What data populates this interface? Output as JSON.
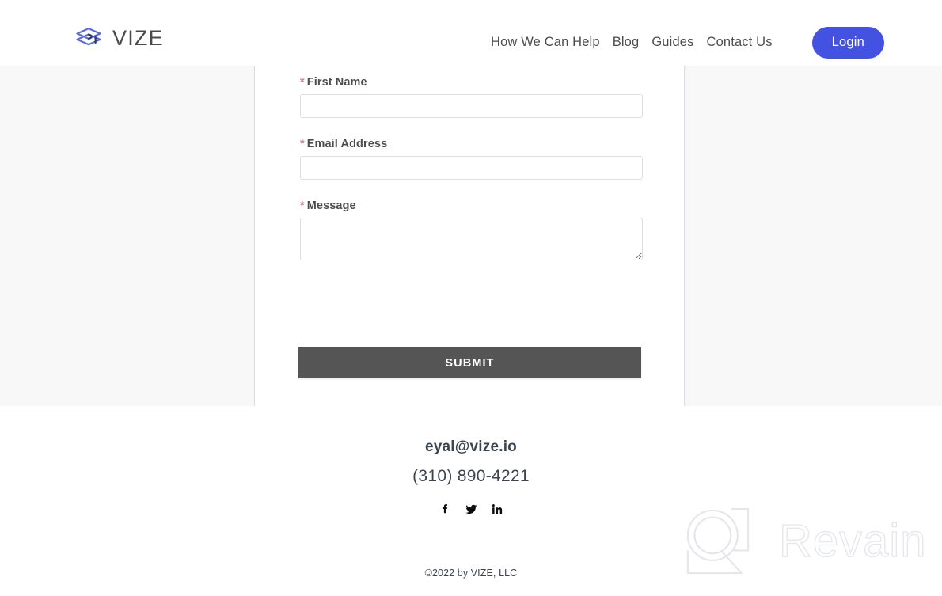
{
  "brand": {
    "name": "VIZE",
    "logo_icon": "graduation-cap-icon",
    "logo_color": "#4352e0"
  },
  "nav": {
    "items": [
      {
        "label": "How We Can Help"
      },
      {
        "label": "Blog"
      },
      {
        "label": "Guides"
      },
      {
        "label": "Contact Us"
      }
    ],
    "login_label": "Login",
    "login_color": "#4352e0"
  },
  "form": {
    "required_marker": "*",
    "fields": [
      {
        "label": "First Name",
        "value": "",
        "placeholder": "",
        "type": "text"
      },
      {
        "label": "Email Address",
        "value": "",
        "placeholder": "",
        "type": "text"
      },
      {
        "label": "Message",
        "value": "",
        "placeholder": "",
        "type": "textarea"
      }
    ],
    "submit_label": "SUBMIT",
    "submit_color": "#555555"
  },
  "footer": {
    "email": "eyal@vize.io",
    "phone": "(310) 890-4221",
    "social": [
      {
        "name": "facebook-icon",
        "label": "f"
      },
      {
        "name": "twitter-icon",
        "label": "twitter"
      },
      {
        "name": "linkedin-icon",
        "label": "in"
      }
    ],
    "copyright": "©2022 by VIZE, LLC"
  },
  "watermark": {
    "text": "Revain",
    "mark_icon": "revain-q-logo-icon",
    "color": "#e4e6ea"
  }
}
